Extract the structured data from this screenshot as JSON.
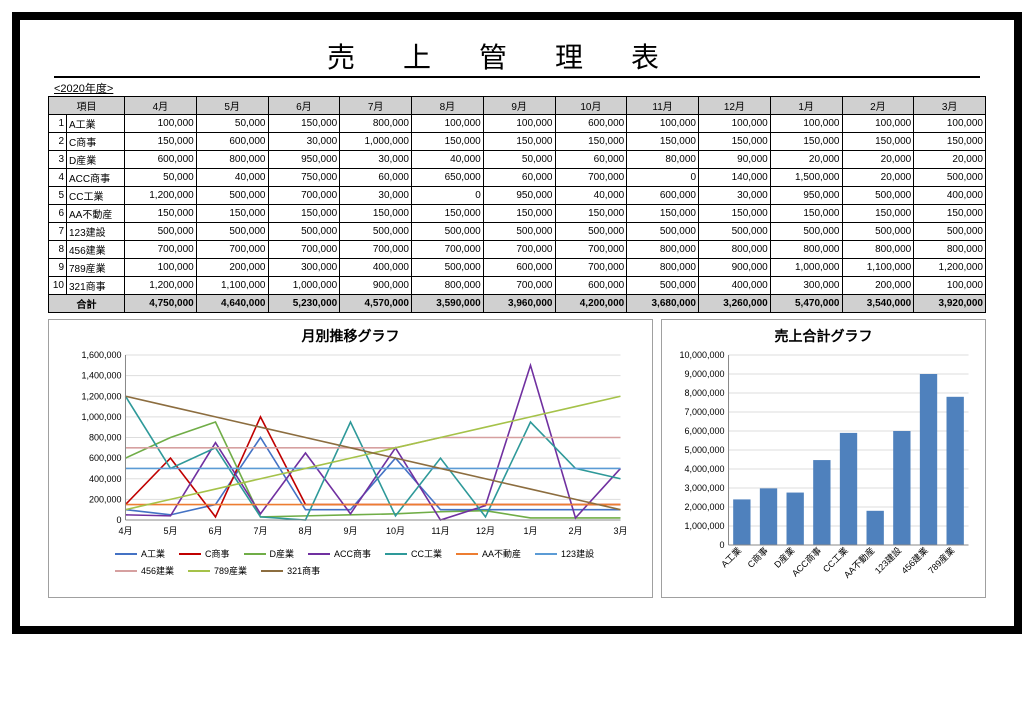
{
  "title_spaced": "売上管理表",
  "fiscal_year": "<2020年度>",
  "header_item": "項目",
  "months": [
    "4月",
    "5月",
    "6月",
    "7月",
    "8月",
    "9月",
    "10月",
    "11月",
    "12月",
    "1月",
    "2月",
    "3月"
  ],
  "rows": [
    {
      "idx": "1",
      "name": "A工業",
      "v": [
        100000,
        50000,
        150000,
        800000,
        100000,
        100000,
        600000,
        100000,
        100000,
        100000,
        100000,
        100000
      ]
    },
    {
      "idx": "2",
      "name": "C商事",
      "v": [
        150000,
        600000,
        30000,
        1000000,
        150000,
        150000,
        150000,
        150000,
        150000,
        150000,
        150000,
        150000
      ]
    },
    {
      "idx": "3",
      "name": "D産業",
      "v": [
        600000,
        800000,
        950000,
        30000,
        40000,
        50000,
        60000,
        80000,
        90000,
        20000,
        20000,
        20000
      ]
    },
    {
      "idx": "4",
      "name": "ACC商事",
      "v": [
        50000,
        40000,
        750000,
        60000,
        650000,
        60000,
        700000,
        0,
        140000,
        1500000,
        20000,
        500000
      ]
    },
    {
      "idx": "5",
      "name": "CC工業",
      "v": [
        1200000,
        500000,
        700000,
        30000,
        0,
        950000,
        40000,
        600000,
        30000,
        950000,
        500000,
        400000
      ]
    },
    {
      "idx": "6",
      "name": "AA不動産",
      "v": [
        150000,
        150000,
        150000,
        150000,
        150000,
        150000,
        150000,
        150000,
        150000,
        150000,
        150000,
        150000
      ]
    },
    {
      "idx": "7",
      "name": "123建設",
      "v": [
        500000,
        500000,
        500000,
        500000,
        500000,
        500000,
        500000,
        500000,
        500000,
        500000,
        500000,
        500000
      ]
    },
    {
      "idx": "8",
      "name": "456建業",
      "v": [
        700000,
        700000,
        700000,
        700000,
        700000,
        700000,
        700000,
        800000,
        800000,
        800000,
        800000,
        800000
      ]
    },
    {
      "idx": "9",
      "name": "789産業",
      "v": [
        100000,
        200000,
        300000,
        400000,
        500000,
        600000,
        700000,
        800000,
        900000,
        1000000,
        1100000,
        1200000
      ]
    },
    {
      "idx": "10",
      "name": "321商事",
      "v": [
        1200000,
        1100000,
        1000000,
        900000,
        800000,
        700000,
        600000,
        500000,
        400000,
        300000,
        200000,
        100000
      ]
    }
  ],
  "total_label": "合計",
  "totals": [
    4750000,
    4640000,
    5230000,
    4570000,
    3590000,
    3960000,
    4200000,
    3680000,
    3260000,
    5470000,
    3540000,
    3920000
  ],
  "line_chart_title": "月別推移グラフ",
  "bar_chart_title": "売上合計グラフ",
  "colors": {
    "A工業": "#4472c4",
    "C商事": "#c00000",
    "D産業": "#70ad47",
    "ACC商事": "#7030a0",
    "CC工業": "#2e9999",
    "AA不動産": "#ed7d31",
    "123建設": "#5b9bd5",
    "456建業": "#d6a0a0",
    "789産業": "#a5c249",
    "321商事": "#8c6d3f"
  },
  "chart_data": [
    {
      "type": "line",
      "title": "月別推移グラフ",
      "xlabel": "",
      "ylabel": "",
      "categories": [
        "4月",
        "5月",
        "6月",
        "7月",
        "8月",
        "9月",
        "10月",
        "11月",
        "12月",
        "1月",
        "2月",
        "3月"
      ],
      "ylim": [
        0,
        1600000
      ],
      "yticks": [
        0,
        200000,
        400000,
        600000,
        800000,
        1000000,
        1200000,
        1400000,
        1600000
      ],
      "series": [
        {
          "name": "A工業",
          "values": [
            100000,
            50000,
            150000,
            800000,
            100000,
            100000,
            600000,
            100000,
            100000,
            100000,
            100000,
            100000
          ]
        },
        {
          "name": "C商事",
          "values": [
            150000,
            600000,
            30000,
            1000000,
            150000,
            150000,
            150000,
            150000,
            150000,
            150000,
            150000,
            150000
          ]
        },
        {
          "name": "D産業",
          "values": [
            600000,
            800000,
            950000,
            30000,
            40000,
            50000,
            60000,
            80000,
            90000,
            20000,
            20000,
            20000
          ]
        },
        {
          "name": "ACC商事",
          "values": [
            50000,
            40000,
            750000,
            60000,
            650000,
            60000,
            700000,
            0,
            140000,
            1500000,
            20000,
            500000
          ]
        },
        {
          "name": "CC工業",
          "values": [
            1200000,
            500000,
            700000,
            30000,
            0,
            950000,
            40000,
            600000,
            30000,
            950000,
            500000,
            400000
          ]
        },
        {
          "name": "AA不動産",
          "values": [
            150000,
            150000,
            150000,
            150000,
            150000,
            150000,
            150000,
            150000,
            150000,
            150000,
            150000,
            150000
          ]
        },
        {
          "name": "123建設",
          "values": [
            500000,
            500000,
            500000,
            500000,
            500000,
            500000,
            500000,
            500000,
            500000,
            500000,
            500000,
            500000
          ]
        },
        {
          "name": "456建業",
          "values": [
            700000,
            700000,
            700000,
            700000,
            700000,
            700000,
            700000,
            800000,
            800000,
            800000,
            800000,
            800000
          ]
        },
        {
          "name": "789産業",
          "values": [
            100000,
            200000,
            300000,
            400000,
            500000,
            600000,
            700000,
            800000,
            900000,
            1000000,
            1100000,
            1200000
          ]
        },
        {
          "name": "321商事",
          "values": [
            1200000,
            1100000,
            1000000,
            900000,
            800000,
            700000,
            600000,
            500000,
            400000,
            300000,
            200000,
            100000
          ]
        }
      ]
    },
    {
      "type": "bar",
      "title": "売上合計グラフ",
      "xlabel": "",
      "ylabel": "",
      "categories": [
        "A工業",
        "C商事",
        "D産業",
        "ACC商事",
        "CC工業",
        "AA不動産",
        "123建設",
        "456建業",
        "789産業"
      ],
      "values": [
        2400000,
        2980000,
        2760000,
        4470000,
        5900000,
        1800000,
        6000000,
        9000000,
        7800000
      ],
      "ylim": [
        0,
        10000000
      ],
      "yticks": [
        0,
        1000000,
        2000000,
        3000000,
        4000000,
        5000000,
        6000000,
        7000000,
        8000000,
        9000000,
        10000000
      ]
    }
  ]
}
